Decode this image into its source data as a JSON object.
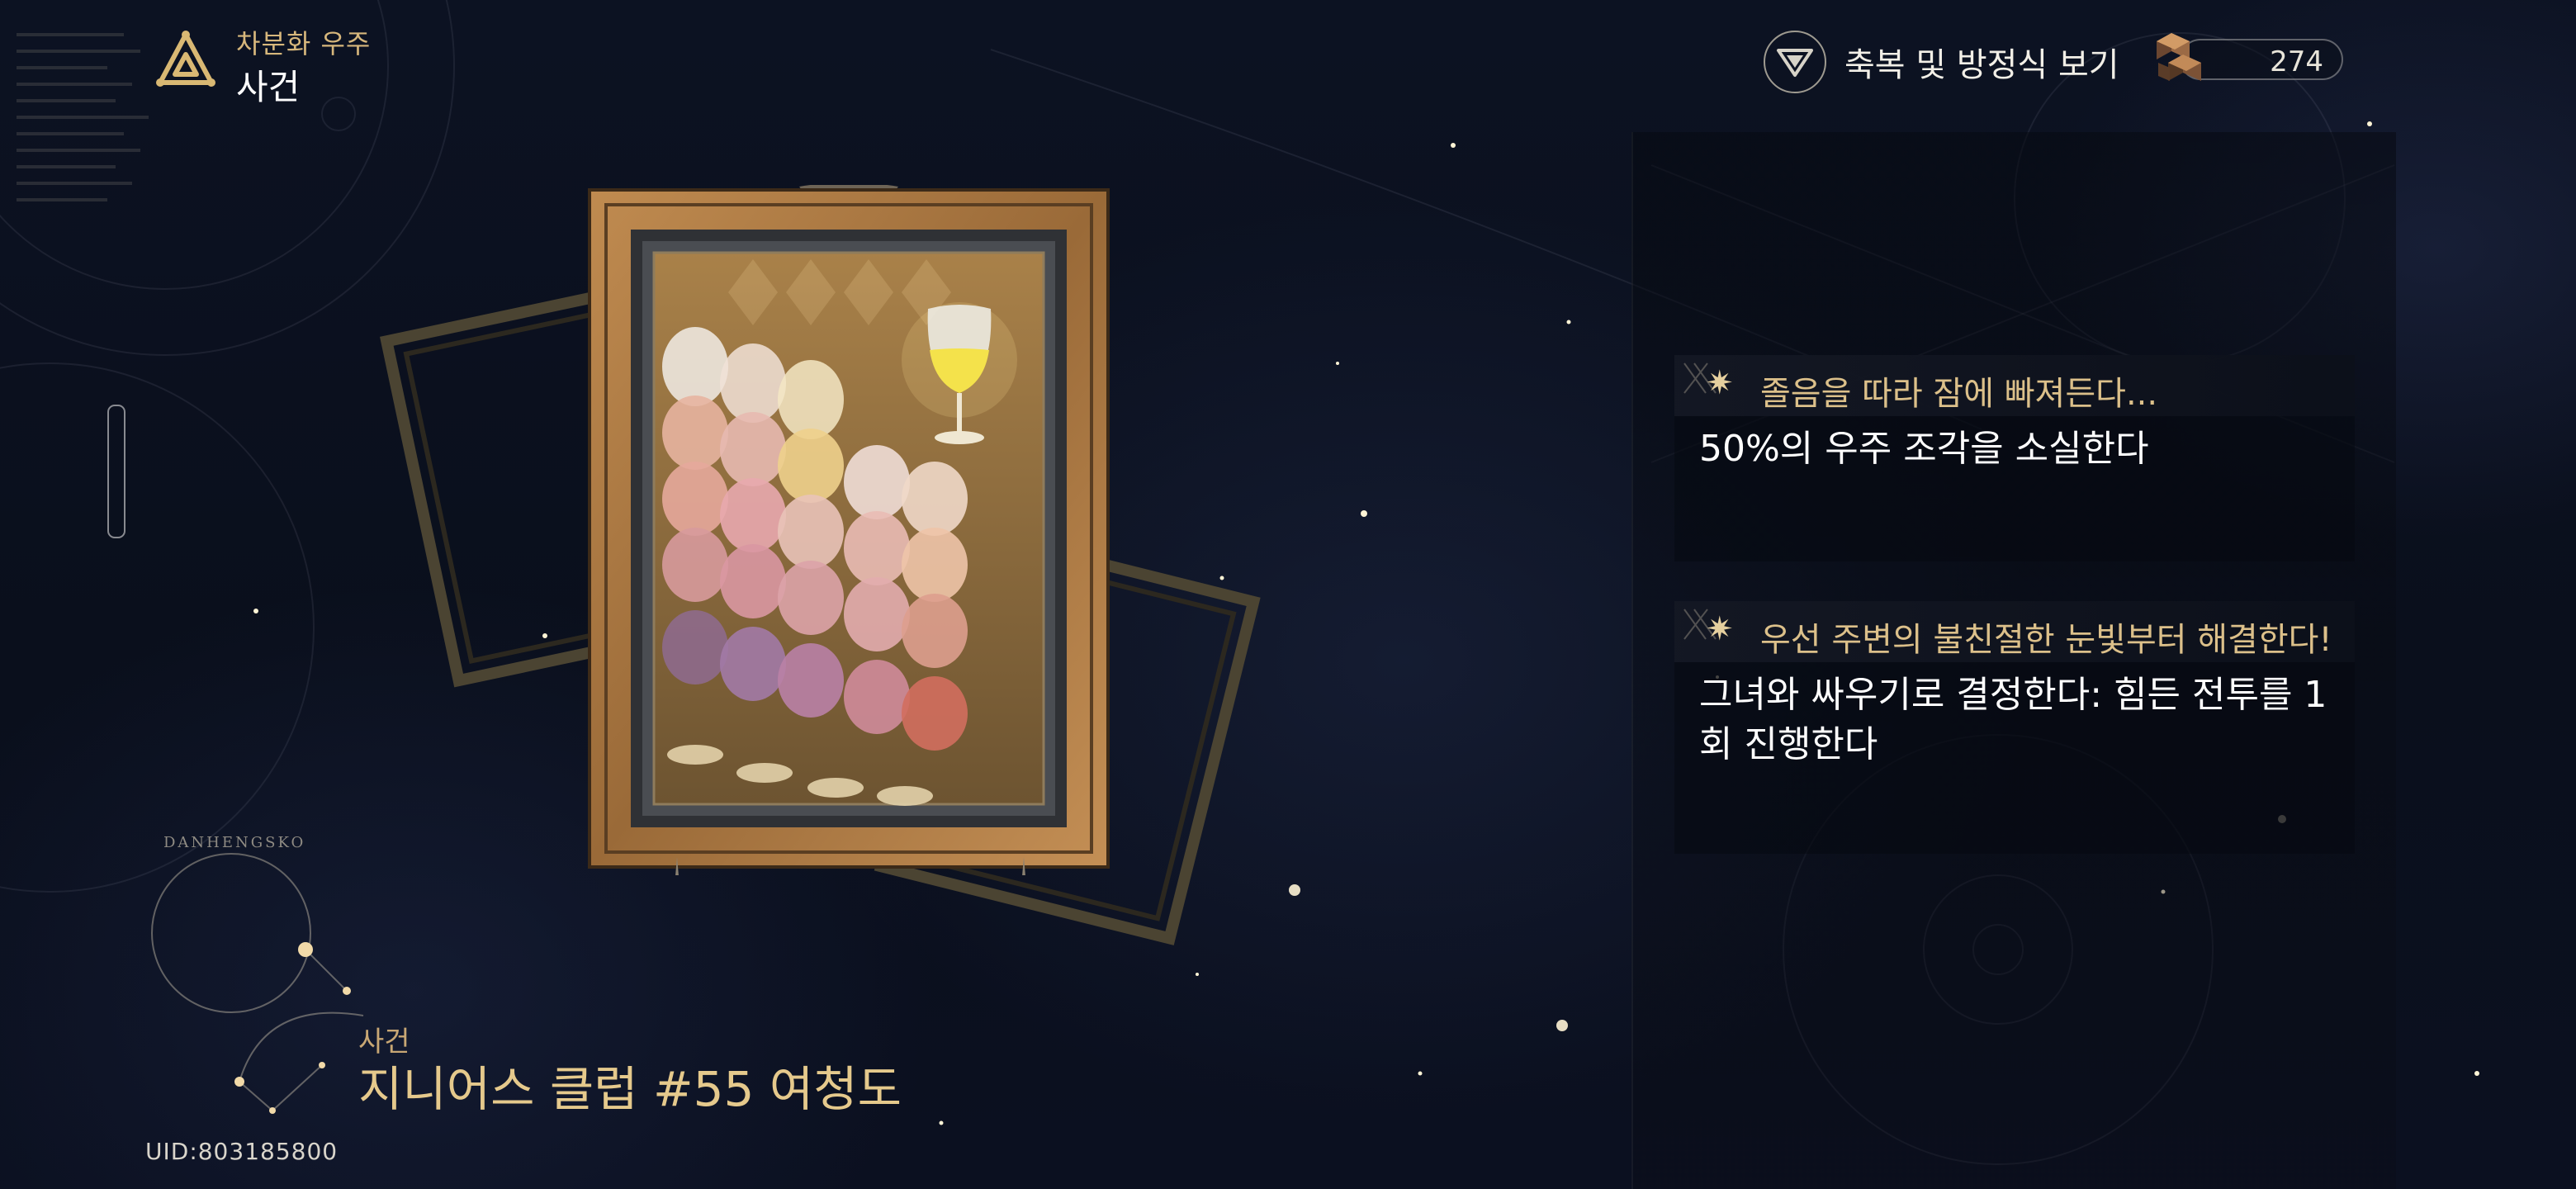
{
  "header": {
    "subtitle": "차분화 우주",
    "title": "사건",
    "logo_icon": "triquetra-logo-icon"
  },
  "top_right": {
    "blessing_label": "축복 및 방정식 보기",
    "blessing_icon": "chevron-down-circle-icon",
    "currency_value": "274",
    "currency_icon": "cosmic-fragment-cube-icon"
  },
  "options": [
    {
      "title": "졸음을 따라 잠에 빠져든다...",
      "description": "50%의 우주 조각을 소실한다"
    },
    {
      "title": "우선 주변의 불친절한 눈빛부터 해결한다!",
      "description": "그녀와 싸우기로 결정한다: 힘든 전투를 1회 진행한다"
    }
  ],
  "event": {
    "category": "사건",
    "name": "지니어스 클럽 #55 여청도"
  },
  "uid": "UID:803185800",
  "constellation_label": "DANHENGSKO",
  "colors": {
    "accent_gold": "#dcc08a",
    "frame_gold": "#b8894a",
    "background": "#0a0f1c"
  }
}
